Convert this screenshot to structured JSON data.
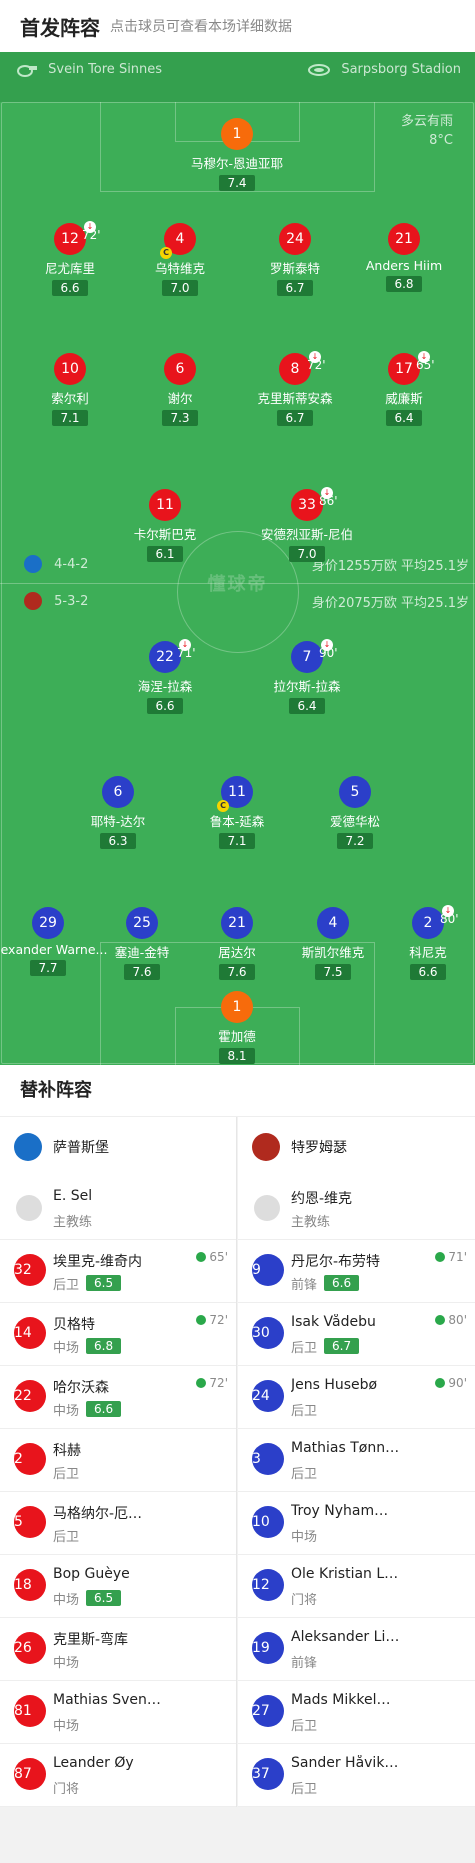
{
  "header": {
    "title": "首发阵容",
    "subtitle": "点击球员可查看本场详细数据"
  },
  "match_info": {
    "referee": "Svein Tore Sinnes",
    "stadium": "Sarpsborg Stadion",
    "weather": "多云有雨",
    "temperature": "8°C",
    "watermark": "懂球帝"
  },
  "home_team": {
    "formation": "4-4-2",
    "value_text": "身价1255万欧 平均25.1岁"
  },
  "away_team": {
    "formation": "5-3-2",
    "value_text": "身价2075万欧 平均25.1岁"
  },
  "home_players": [
    {
      "num": "1",
      "name": "马穆尔-恩迪亚耶",
      "rating": "7.4",
      "goalkeeper": true
    },
    {
      "num": "12",
      "name": "尼尤库里",
      "rating": "6.6",
      "sub_min": "72'"
    },
    {
      "num": "4",
      "name": "乌特维克",
      "rating": "7.0",
      "captain": "C"
    },
    {
      "num": "24",
      "name": "罗斯泰特",
      "rating": "6.7"
    },
    {
      "num": "21",
      "name": "Anders Hiim",
      "rating": "6.8"
    },
    {
      "num": "10",
      "name": "索尔利",
      "rating": "7.1"
    },
    {
      "num": "6",
      "name": "谢尔",
      "rating": "7.3"
    },
    {
      "num": "8",
      "name": "克里斯蒂安森",
      "rating": "6.7",
      "sub_min": "72'"
    },
    {
      "num": "17",
      "name": "威廉斯",
      "rating": "6.4",
      "sub_min": "65'"
    },
    {
      "num": "11",
      "name": "卡尔斯巴克",
      "rating": "6.1"
    },
    {
      "num": "33",
      "name": "安德烈亚斯-尼伯",
      "rating": "7.0",
      "sub_min": "86'"
    }
  ],
  "away_players": [
    {
      "num": "22",
      "name": "海涅-拉森",
      "rating": "6.6",
      "sub_min": "71'"
    },
    {
      "num": "7",
      "name": "拉尔斯-拉森",
      "rating": "6.4",
      "sub_min": "90'"
    },
    {
      "num": "6",
      "name": "耶特-达尔",
      "rating": "6.3"
    },
    {
      "num": "11",
      "name": "鲁本-延森",
      "rating": "7.1",
      "captain": "C"
    },
    {
      "num": "5",
      "name": "爱德华松",
      "rating": "7.2"
    },
    {
      "num": "29",
      "name": "Alexander Warne...",
      "rating": "7.7"
    },
    {
      "num": "25",
      "name": "塞迪-金特",
      "rating": "7.6"
    },
    {
      "num": "21",
      "name": "居达尔",
      "rating": "7.6"
    },
    {
      "num": "4",
      "name": "斯凯尔维克",
      "rating": "7.5"
    },
    {
      "num": "2",
      "name": "科尼克",
      "rating": "6.6",
      "sub_min": "80'"
    },
    {
      "num": "1",
      "name": "霍加德",
      "rating": "8.1",
      "goalkeeper": true
    }
  ],
  "subs": {
    "title": "替补阵容",
    "home": {
      "team": "萨普斯堡",
      "coach": "E. Sel",
      "coach_role": "主教练",
      "players": [
        {
          "num": "32",
          "name": "埃里克-维奇内",
          "pos": "后卫",
          "rating": "6.5",
          "min": "65'"
        },
        {
          "num": "14",
          "name": "贝格特",
          "pos": "中场",
          "rating": "6.8",
          "min": "72'"
        },
        {
          "num": "22",
          "name": "哈尔沃森",
          "pos": "中场",
          "rating": "6.6",
          "min": "72'"
        },
        {
          "num": "2",
          "name": "科赫",
          "pos": "后卫"
        },
        {
          "num": "5",
          "name": "马格纳尔-厄…",
          "pos": "后卫"
        },
        {
          "num": "18",
          "name": "Bop Guèye",
          "pos": "中场",
          "rating": "6.5"
        },
        {
          "num": "26",
          "name": "克里斯-弯库",
          "pos": "中场"
        },
        {
          "num": "81",
          "name": "Mathias Sven…",
          "pos": "中场"
        },
        {
          "num": "87",
          "name": "Leander Øy",
          "pos": "门将"
        }
      ]
    },
    "away": {
      "team": "特罗姆瑟",
      "coach": "约恩-维克",
      "coach_role": "主教练",
      "players": [
        {
          "num": "9",
          "name": "丹尼尔-布劳特",
          "pos": "前锋",
          "rating": "6.6",
          "min": "71'"
        },
        {
          "num": "30",
          "name": "Isak Vådebu",
          "pos": "后卫",
          "rating": "6.7",
          "min": "80'"
        },
        {
          "num": "24",
          "name": "Jens Husebø",
          "pos": "后卫",
          "min": "90'"
        },
        {
          "num": "3",
          "name": "Mathias Tønn…",
          "pos": "后卫"
        },
        {
          "num": "10",
          "name": "Troy Nyham…",
          "pos": "中场"
        },
        {
          "num": "12",
          "name": "Ole Kristian L…",
          "pos": "门将"
        },
        {
          "num": "19",
          "name": "Aleksander Li…",
          "pos": "前锋"
        },
        {
          "num": "27",
          "name": "Mads Mikkel…",
          "pos": "后卫"
        },
        {
          "num": "37",
          "name": "Sander Håvik…",
          "pos": "后卫"
        }
      ]
    }
  }
}
